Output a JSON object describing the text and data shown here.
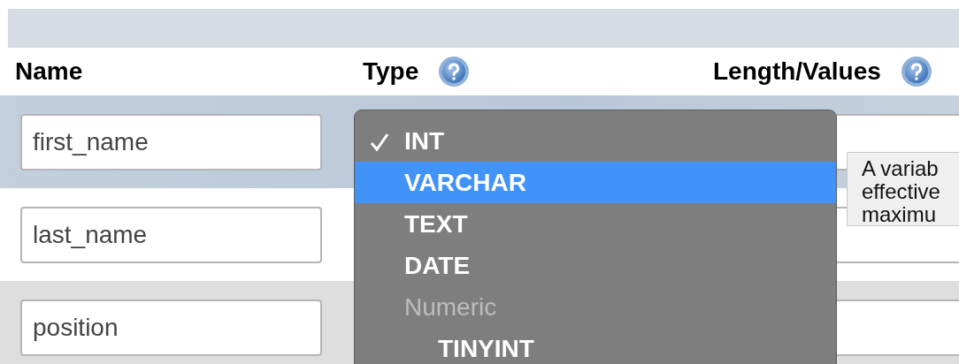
{
  "columns": [
    {
      "label": "Name",
      "help": false
    },
    {
      "label": "Type",
      "help": true
    },
    {
      "label": "Length/Values",
      "help": true
    }
  ],
  "rows": [
    {
      "name": "first_name",
      "selected": true
    },
    {
      "name": "last_name",
      "selected": false
    },
    {
      "name": "position",
      "selected": false
    }
  ],
  "type_menu": {
    "items": [
      {
        "kind": "option",
        "label": "INT",
        "checked": true,
        "selected": false
      },
      {
        "kind": "option",
        "label": "VARCHAR",
        "checked": false,
        "selected": true
      },
      {
        "kind": "option",
        "label": "TEXT",
        "checked": false,
        "selected": false
      },
      {
        "kind": "option",
        "label": "DATE",
        "checked": false,
        "selected": false
      },
      {
        "kind": "group",
        "label": "Numeric",
        "children": [
          {
            "kind": "option",
            "label": "TINYINT",
            "checked": false,
            "selected": false
          }
        ]
      }
    ]
  },
  "tooltip": {
    "lines": [
      "A variab",
      "effective",
      "maximu"
    ]
  }
}
